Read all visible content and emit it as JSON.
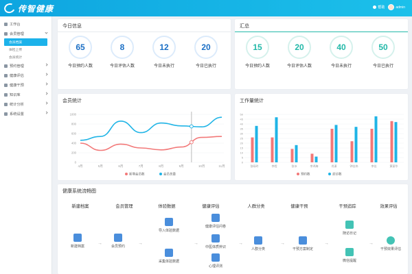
{
  "header": {
    "logo": "传智健康",
    "notice": "帮助",
    "user": "admin"
  },
  "sidebar": {
    "items": [
      {
        "label": "工作台",
        "expanded": false,
        "sub": []
      },
      {
        "label": "会员管理",
        "expanded": true,
        "sub": [
          "会员档案",
          "体检上传",
          "会员统计"
        ]
      },
      {
        "label": "预约管理",
        "expanded": false,
        "sub": []
      },
      {
        "label": "健康评估",
        "expanded": false,
        "sub": []
      },
      {
        "label": "健康干预",
        "expanded": false,
        "sub": []
      },
      {
        "label": "知识库",
        "expanded": false,
        "sub": []
      },
      {
        "label": "统计分析",
        "expanded": false,
        "sub": []
      },
      {
        "label": "系统设置",
        "expanded": false,
        "sub": []
      }
    ]
  },
  "today": {
    "title": "今日信息",
    "stats": [
      {
        "value": "65",
        "label": "今日预约人数",
        "color": "#1b6fc5"
      },
      {
        "value": "8",
        "label": "今日评估人数",
        "color": "#1b6fc5"
      },
      {
        "value": "12",
        "label": "今日未执行",
        "color": "#1b6fc5"
      },
      {
        "value": "20",
        "label": "今日已执行",
        "color": "#1b6fc5"
      }
    ]
  },
  "summary": {
    "title": "汇总",
    "stats": [
      {
        "value": "15",
        "label": "今日预约人数",
        "color": "#22b8a8"
      },
      {
        "value": "20",
        "label": "今日评估人数",
        "color": "#22b8a8"
      },
      {
        "value": "40",
        "label": "今日未执行",
        "color": "#22b8a8"
      },
      {
        "value": "50",
        "label": "今日已执行",
        "color": "#22b8a8"
      }
    ]
  },
  "member_chart_title": "会员统计",
  "work_chart_title": "工作量统计",
  "flow": {
    "title": "健康系统流畅图",
    "heads": [
      "新建档案",
      "会员管理",
      "体验数据",
      "健康评估",
      "人群分类",
      "健康干预",
      "干预追踪",
      "效果评估"
    ],
    "nodes": [
      "新建档案",
      "会员预约",
      "导入体验数据",
      "采集体验数据",
      "健康评估问卷",
      "中医体质辨识",
      "心理评测",
      "人群分类",
      "干预方案制定",
      "随访日记",
      "微信提醒",
      "干预效果评估"
    ]
  },
  "chart_data": [
    {
      "type": "line",
      "title": "会员统计",
      "categories": [
        "4月",
        "5月",
        "6月",
        "7月",
        "8月",
        "9月",
        "10月",
        "11月"
      ],
      "ylim": [
        0,
        1000
      ],
      "yticks": [
        0,
        200,
        400,
        600,
        800,
        1000
      ],
      "series": [
        {
          "name": "新增会员数",
          "color": "#f27878",
          "values": [
            400,
            250,
            380,
            300,
            260,
            320,
            520,
            540
          ]
        },
        {
          "name": "会员总量",
          "color": "#1fb4e6",
          "values": [
            460,
            540,
            860,
            620,
            820,
            760,
            740,
            940
          ]
        }
      ]
    },
    {
      "type": "bar",
      "title": "工作量统计",
      "categories": [
        "张旸玲",
        "李程",
        "张冰",
        "李鸿梅",
        "肖潇",
        "钟佳伟",
        "李佳",
        "黄丽华"
      ],
      "ylim": [
        0,
        50
      ],
      "yticks": [
        0,
        5,
        10,
        15,
        20,
        25,
        30,
        35,
        40,
        45,
        50
      ],
      "series": [
        {
          "name": "预约数",
          "color": "#f27878",
          "values": [
            26,
            26,
            14,
            9,
            35,
            22,
            35,
            43
          ]
        },
        {
          "name": "封诊数",
          "color": "#1fb4e6",
          "values": [
            38,
            47,
            18,
            6,
            39,
            37,
            48,
            42
          ]
        }
      ]
    }
  ]
}
